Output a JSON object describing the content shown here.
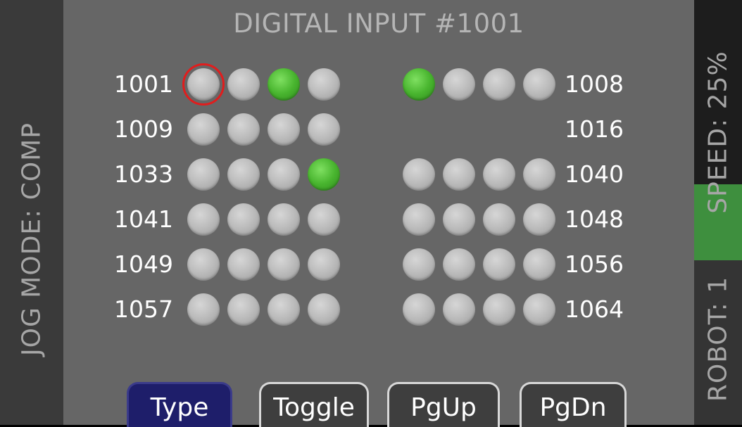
{
  "title": "DIGITAL INPUT #1001",
  "jog_mode": "JOG MODE: COMP",
  "speed": "SPEED: 25%",
  "robot": "ROBOT: 1",
  "colors": {
    "led_on": "#49b52f",
    "led_off": "#bdbdbd",
    "selection": "#e11d1d",
    "speed_highlight": "#3e8f3e",
    "active_key": "#1e1e6a"
  },
  "rows": [
    {
      "left_label": "1001",
      "right_label": "1008",
      "left": [
        0,
        0,
        1,
        0
      ],
      "right": [
        1,
        0,
        0,
        0
      ],
      "right_visible": true
    },
    {
      "left_label": "1009",
      "right_label": "1016",
      "left": [
        0,
        0,
        0,
        0
      ],
      "right": [
        0,
        0,
        0,
        0
      ],
      "right_visible": false
    },
    {
      "left_label": "1033",
      "right_label": "1040",
      "left": [
        0,
        0,
        0,
        1
      ],
      "right": [
        0,
        0,
        0,
        0
      ],
      "right_visible": true
    },
    {
      "left_label": "1041",
      "right_label": "1048",
      "left": [
        0,
        0,
        0,
        0
      ],
      "right": [
        0,
        0,
        0,
        0
      ],
      "right_visible": true
    },
    {
      "left_label": "1049",
      "right_label": "1056",
      "left": [
        0,
        0,
        0,
        0
      ],
      "right": [
        0,
        0,
        0,
        0
      ],
      "right_visible": true
    },
    {
      "left_label": "1057",
      "right_label": "1064",
      "left": [
        0,
        0,
        0,
        0
      ],
      "right": [
        0,
        0,
        0,
        0
      ],
      "right_visible": true
    }
  ],
  "selected_input": "1001",
  "softkeys": [
    {
      "label": "Type",
      "active": true
    },
    {
      "label": "Toggle",
      "active": false
    },
    {
      "label": "PgUp",
      "active": false
    },
    {
      "label": "PgDn",
      "active": false
    }
  ]
}
